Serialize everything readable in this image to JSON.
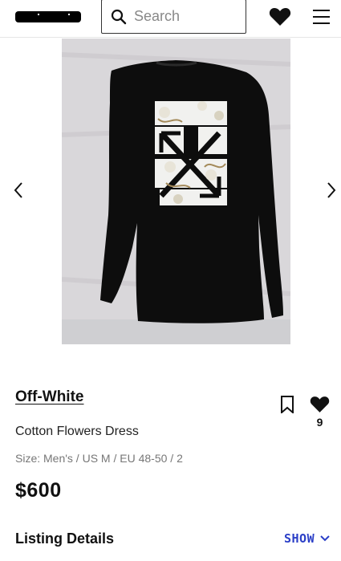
{
  "header": {
    "search_placeholder": "Search",
    "icons": [
      "search-icon",
      "heart-icon",
      "hamburger-menu-icon"
    ]
  },
  "gallery": {
    "image_description": "Black long-sleeve shirt with white arrows and flower print on back",
    "prev_icon": "chevron-left-icon",
    "next_icon": "chevron-right-icon"
  },
  "product": {
    "brand": "Off-White",
    "title": "Cotton Flowers Dress",
    "size": "Size: Men's / US M / EU 48-50 / 2",
    "price": "$600",
    "likes": "9"
  },
  "details": {
    "title": "Listing Details",
    "toggle_label": "SHOW"
  },
  "colors": {
    "text": "#111111",
    "muted": "#777777",
    "accent": "#2b3fc7",
    "shirt": "#0d0d0d",
    "background": "#d8d6d8"
  }
}
